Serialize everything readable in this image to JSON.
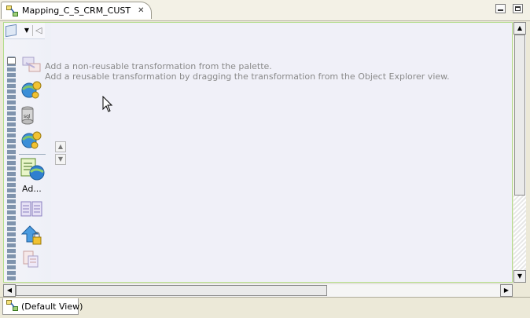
{
  "editor_tab": {
    "title": "Mapping_C_S_CRM_CUST",
    "close_icon": "close-icon"
  },
  "window_controls": {
    "minimize_icon": "minimize-icon",
    "maximize_icon": "maximize-icon"
  },
  "palette": {
    "toolbar": [
      "palette-icon",
      "dropdown-icon",
      "collapse-icon"
    ],
    "items": [
      {
        "name": "transformation-1",
        "icon": "transformation-icon"
      },
      {
        "name": "transformation-2",
        "icon": "globe-gear-icon"
      },
      {
        "name": "transformation-3",
        "icon": "sql-icon"
      },
      {
        "name": "transformation-4",
        "icon": "globe-gear-icon"
      },
      {
        "name": "transformation-5",
        "icon": "address-globe-icon",
        "label": "Ad..."
      },
      {
        "name": "transformation-6",
        "icon": "table-icon"
      },
      {
        "name": "transformation-7",
        "icon": "upload-lock-icon"
      },
      {
        "name": "transformation-8",
        "icon": "document-icon"
      }
    ]
  },
  "canvas": {
    "hint_line_1": "Add a non-reusable transformation from the palette.",
    "hint_line_2": "Add a reusable transformation by dragging the transformation from the Object Explorer view."
  },
  "view_tab": {
    "label": "(Default View)",
    "icon": "mapping-view-icon"
  },
  "colors": {
    "canvas_bg": "#f0f0f8",
    "frame_border": "#b2dc8b",
    "hint_text": "#8a8a8a"
  }
}
